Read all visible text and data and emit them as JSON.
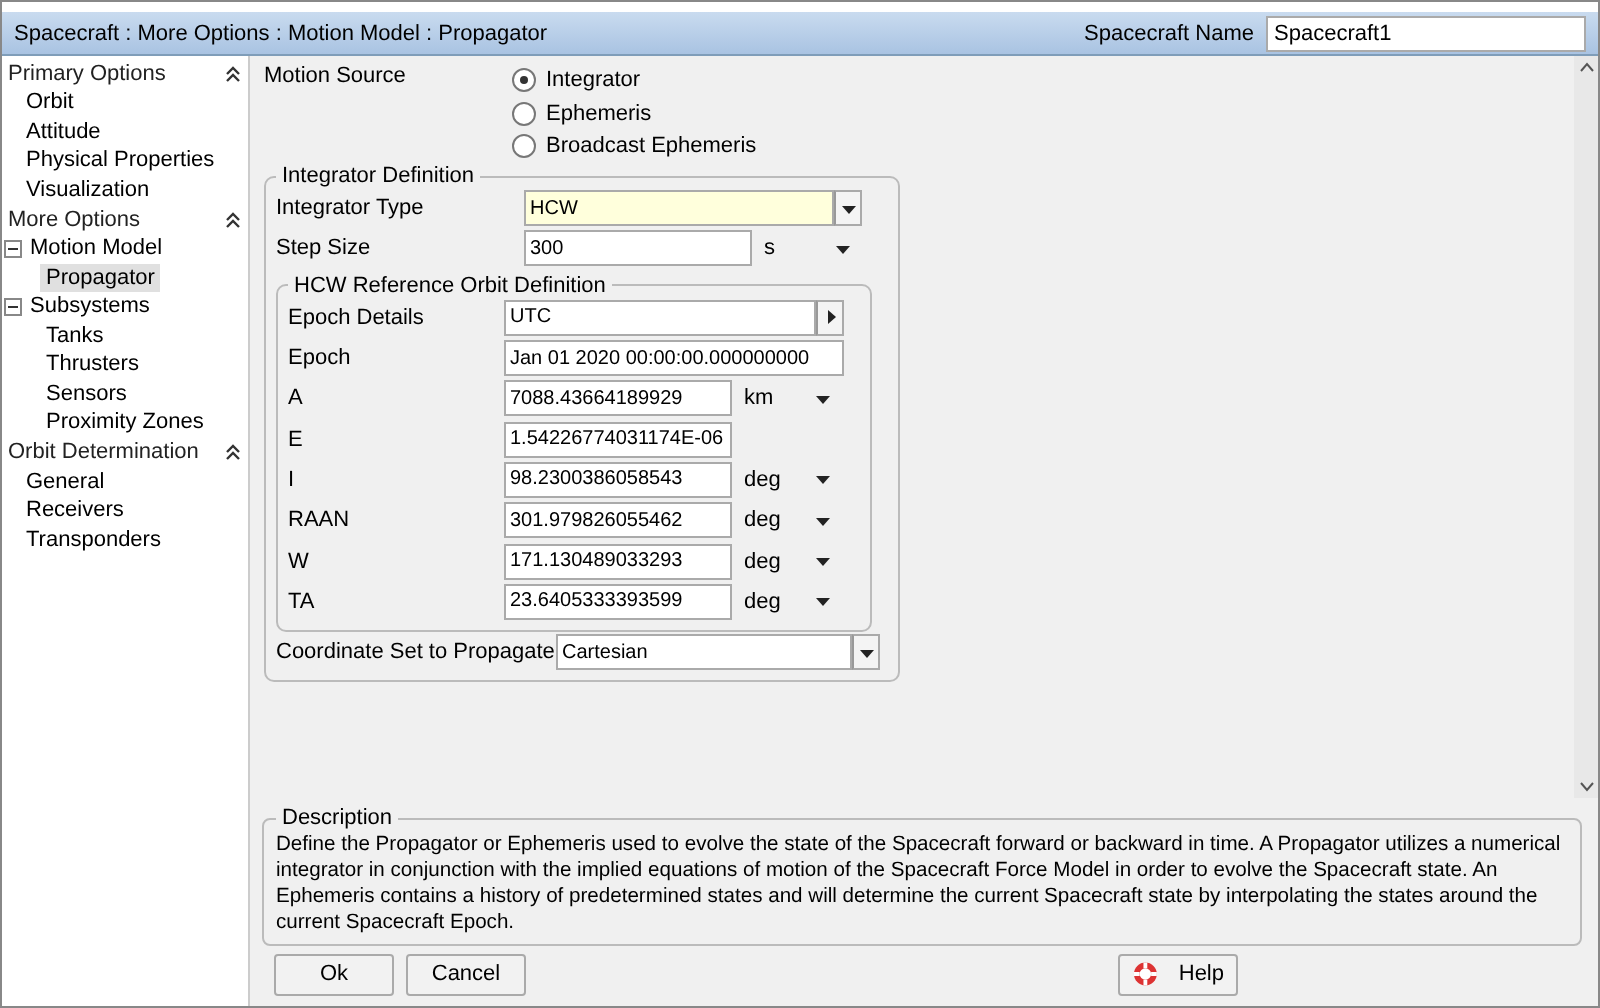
{
  "window": {
    "title": "Spacecraft : More Options : Motion Model : Propagator",
    "name_label": "Spacecraft Name",
    "name_value": "Spacecraft1"
  },
  "sidebar": {
    "sections": [
      {
        "title": "Primary Options",
        "items": [
          {
            "label": "Orbit",
            "selected": false
          },
          {
            "label": "Attitude",
            "selected": false
          },
          {
            "label": "Physical Properties",
            "selected": false
          },
          {
            "label": "Visualization",
            "selected": false
          }
        ]
      },
      {
        "title": "More Options",
        "items": [
          {
            "label": "Motion Model",
            "selected": false,
            "expanded": true,
            "children": [
              {
                "label": "Propagator",
                "selected": true
              }
            ]
          },
          {
            "label": "Subsystems",
            "selected": false,
            "expanded": true,
            "children": [
              {
                "label": "Tanks",
                "selected": false
              },
              {
                "label": "Thrusters",
                "selected": false
              },
              {
                "label": "Sensors",
                "selected": false
              },
              {
                "label": "Proximity Zones",
                "selected": false
              }
            ]
          }
        ]
      },
      {
        "title": "Orbit Determination",
        "items": [
          {
            "label": "General",
            "selected": false
          },
          {
            "label": "Receivers",
            "selected": false
          },
          {
            "label": "Transponders",
            "selected": false
          }
        ]
      }
    ]
  },
  "motion_source": {
    "label": "Motion Source",
    "options": [
      {
        "label": "Integrator",
        "selected": true
      },
      {
        "label": "Ephemeris",
        "selected": false
      },
      {
        "label": "Broadcast Ephemeris",
        "selected": false
      }
    ]
  },
  "integrator_definition": {
    "title": "Integrator Definition",
    "rows": [
      {
        "kind": "select",
        "label": "Integrator Type",
        "value": "HCW",
        "highlighted": true
      },
      {
        "kind": "unit",
        "label": "Step Size",
        "value": "300",
        "unit": "s"
      }
    ],
    "hcw": {
      "title": "HCW Reference Orbit Definition",
      "rows": [
        {
          "kind": "submenu",
          "label": "Epoch Details",
          "value": "UTC"
        },
        {
          "kind": "wide",
          "label": "Epoch",
          "value": "Jan 01 2020 00:00:00.000000000"
        },
        {
          "kind": "unit",
          "label": "A",
          "value": "7088.43664189929",
          "unit": "km"
        },
        {
          "kind": "plain",
          "label": "E",
          "value": "1.54226774031174E-06"
        },
        {
          "kind": "unit",
          "label": "I",
          "value": "98.2300386058543",
          "unit": "deg"
        },
        {
          "kind": "unit",
          "label": "RAAN",
          "value": "301.979826055462",
          "unit": "deg"
        },
        {
          "kind": "unit",
          "label": "W",
          "value": "171.130489033293",
          "unit": "deg"
        },
        {
          "kind": "unit",
          "label": "TA",
          "value": "23.6405333393599",
          "unit": "deg"
        }
      ]
    },
    "coordinate": {
      "kind": "select",
      "label": "Coordinate Set to Propagate",
      "value": "Cartesian",
      "highlighted": false
    }
  },
  "description": {
    "title": "Description",
    "text": "Define the Propagator or Ephemeris used to evolve the state of the Spacecraft forward or backward in time. A Propagator utilizes a numerical integrator in conjunction with the implied equations of motion of the Spacecraft Force Model in order to evolve the Spacecraft state. An Ephemeris contains a history of predetermined states and will determine the current Spacecraft state by interpolating the states around the current Spacecraft Epoch."
  },
  "buttons": [
    {
      "kind": "ok",
      "label": "Ok"
    },
    {
      "kind": "cancel",
      "label": "Cancel"
    },
    {
      "kind": "help",
      "label": "Help"
    }
  ]
}
